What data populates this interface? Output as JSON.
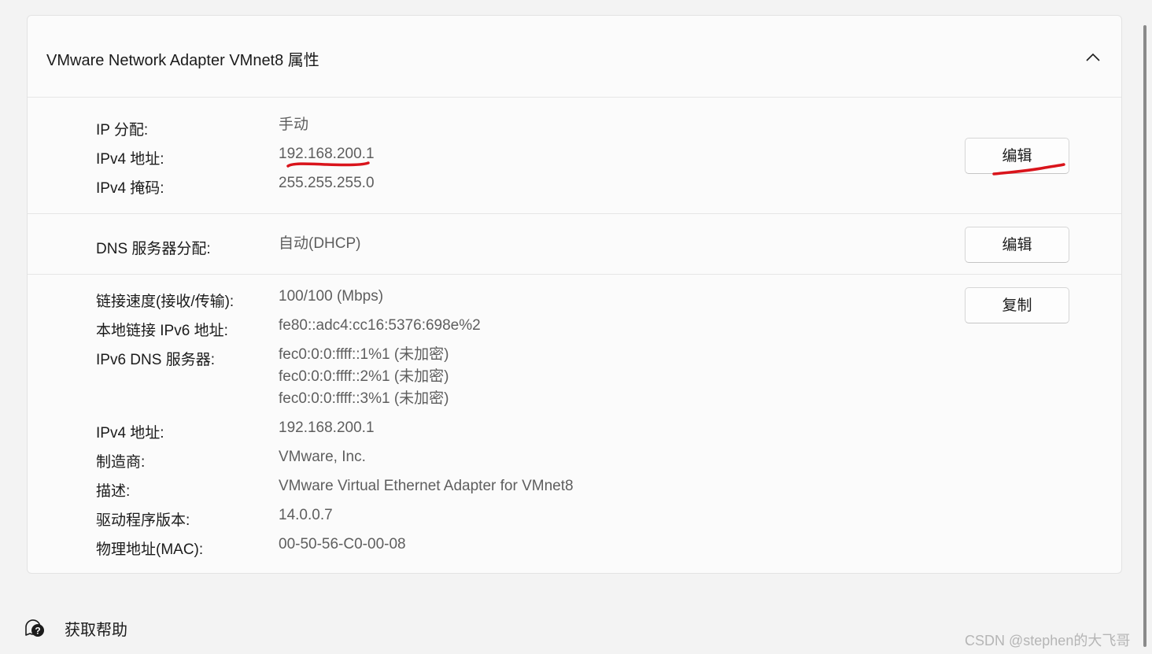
{
  "card": {
    "title": "VMware Network Adapter VMnet8 属性",
    "collapse_icon": "chevron-up-icon"
  },
  "ip_section": {
    "rows": [
      {
        "label": "IP 分配:",
        "value": "手动"
      },
      {
        "label": "IPv4 地址:",
        "value": "192.168.200.1"
      },
      {
        "label": "IPv4 掩码:",
        "value": "255.255.255.0"
      }
    ],
    "edit_label": "编辑"
  },
  "dns_section": {
    "label": "DNS 服务器分配:",
    "value": "自动(DHCP)",
    "edit_label": "编辑"
  },
  "details_section": {
    "copy_label": "复制",
    "rows": [
      {
        "label": "链接速度(接收/传输):",
        "value": "100/100 (Mbps)"
      },
      {
        "label": "本地链接 IPv6 地址:",
        "value": "fe80::adc4:cc16:5376:698e%2"
      },
      {
        "label": "IPv6 DNS 服务器:",
        "values": [
          "fec0:0:0:ffff::1%1 (未加密)",
          "fec0:0:0:ffff::2%1 (未加密)",
          "fec0:0:0:ffff::3%1 (未加密)"
        ]
      },
      {
        "label": "IPv4 地址:",
        "value": "192.168.200.1"
      },
      {
        "label": "制造商:",
        "value": "VMware, Inc."
      },
      {
        "label": "描述:",
        "value": "VMware Virtual Ethernet Adapter for VMnet8"
      },
      {
        "label": "驱动程序版本:",
        "value": "14.0.0.7"
      },
      {
        "label": "物理地址(MAC):",
        "value": "00-50-56-C0-00-08"
      }
    ]
  },
  "help": {
    "label": "获取帮助",
    "icon": "help-chat-icon"
  },
  "watermark": "CSDN @stephen的大飞哥",
  "colors": {
    "background": "#f3f3f3",
    "card": "#fbfbfb",
    "annotation_red": "#d9141b",
    "value_text": "#5e5e5e"
  }
}
